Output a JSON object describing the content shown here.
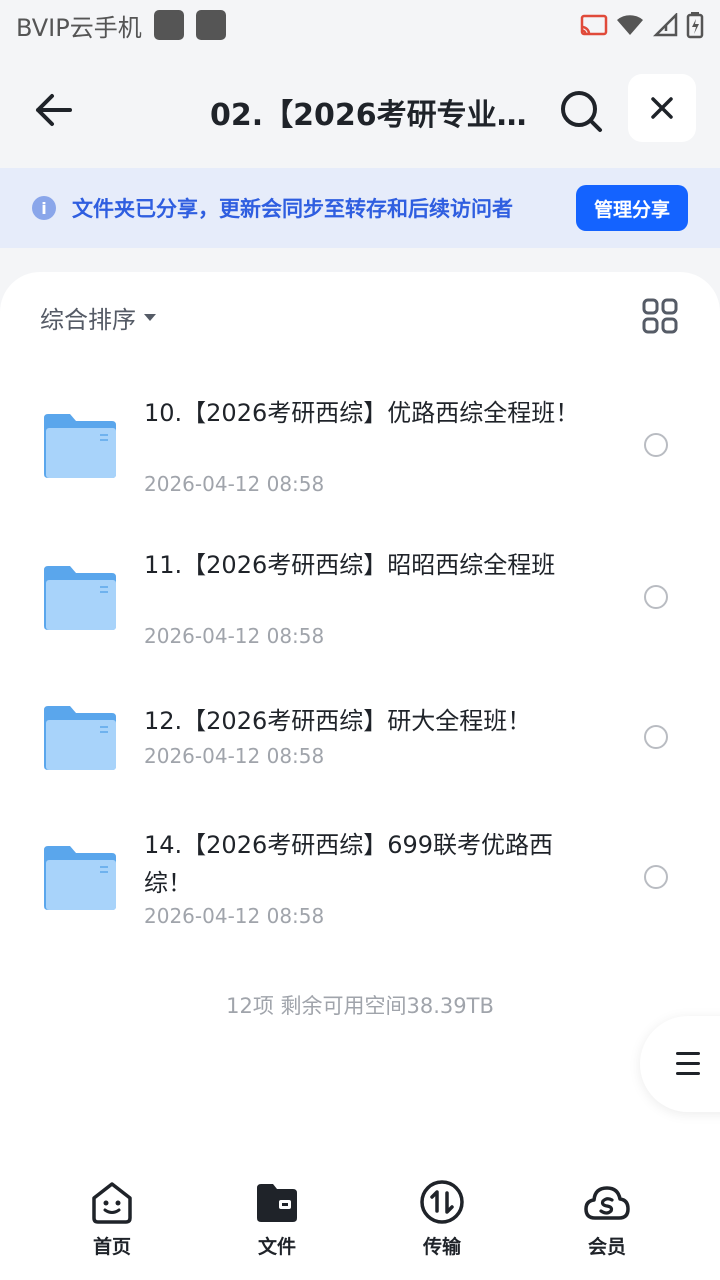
{
  "status_bar": {
    "carrier": "BVIP云手机",
    "icons": [
      "app-square-icon",
      "app-square-icon",
      "cast-icon",
      "wifi-icon",
      "signal-icon",
      "battery-icon"
    ]
  },
  "header": {
    "title": "02.【2026考研专业…",
    "icons": [
      "back-arrow-icon",
      "search-icon",
      "close-icon"
    ]
  },
  "banner": {
    "text": "文件夹已分享，更新会同步至转存和后续访问者",
    "button": "管理分享",
    "accent": "#1463ff"
  },
  "toolbar": {
    "sort_label": "综合排序",
    "view_icon": "grid-view-icon"
  },
  "files": [
    {
      "name": "10.【2026考研西综】优路西综全程班！",
      "date": "2026-04-12 08:58"
    },
    {
      "name": "11.【2026考研西综】昭昭西综全程班",
      "date": "2026-04-12 08:58"
    },
    {
      "name": "12.【2026考研西综】研大全程班！",
      "date": "2026-04-12 08:58"
    },
    {
      "name": "14.【2026考研西综】699联考优路西综！",
      "date": "2026-04-12 08:58"
    }
  ],
  "footer": {
    "count": "12项 剩余可用空间38.39TB"
  },
  "bottom_nav": [
    {
      "label": "首页",
      "icon": "home-face-icon"
    },
    {
      "label": "文件",
      "icon": "folder-icon"
    },
    {
      "label": "传输",
      "icon": "transfer-icon"
    },
    {
      "label": "会员",
      "icon": "cloud-member-icon"
    }
  ],
  "colors": {
    "banner_bg": "#e6ecfa",
    "banner_text": "#2f5ee0",
    "folder": "#64aef0"
  }
}
